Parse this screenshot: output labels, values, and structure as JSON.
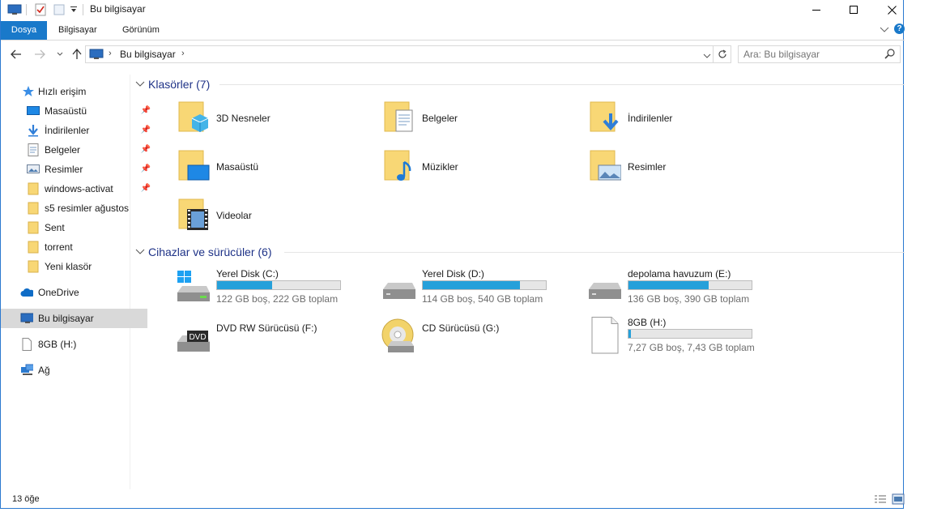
{
  "window": {
    "title": "Bu bilgisayar"
  },
  "ribbon": {
    "tabs": [
      "Dosya",
      "Bilgisayar",
      "Görünüm"
    ]
  },
  "address": {
    "location": "Bu bilgisayar"
  },
  "search": {
    "placeholder": "Ara: Bu bilgisayar"
  },
  "sidebar": {
    "quick_access": "Hızlı erişim",
    "items": [
      "Masaüstü",
      "İndirilenler",
      "Belgeler",
      "Resimler",
      "windows-activat",
      "s5 resimler ağustos",
      "Sent",
      "torrent",
      "Yeni klasör"
    ],
    "onedrive": "OneDrive",
    "this_pc": "Bu bilgisayar",
    "usb": "8GB (H:)",
    "network": "Ağ"
  },
  "folders": {
    "heading": "Klasörler (7)",
    "items": [
      "3D Nesneler",
      "Belgeler",
      "İndirilenler",
      "Masaüstü",
      "Müzikler",
      "Resimler",
      "Videolar"
    ]
  },
  "devices": {
    "heading": "Cihazlar ve sürücüler (6)",
    "items": [
      {
        "name": "Yerel Disk (C:)",
        "info": "122 GB boş, 222 GB toplam",
        "used": 0.45
      },
      {
        "name": "Yerel Disk (D:)",
        "info": "114 GB boş, 540 GB toplam",
        "used": 0.79
      },
      {
        "name": "depolama havuzum (E:)",
        "info": "136 GB boş, 390 GB toplam",
        "used": 0.65
      },
      {
        "name": "DVD RW Sürücüsü (F:)"
      },
      {
        "name": "CD Sürücüsü (G:)"
      },
      {
        "name": "8GB (H:)",
        "info": "7,27 GB boş, 7,43 GB toplam",
        "used": 0.02
      }
    ]
  },
  "status": {
    "count": "13 öğe"
  },
  "icons": {
    "dvd_label": "DVD"
  },
  "colors": {
    "accent": "#1979ca",
    "bar_fill": "#26a0da",
    "section_heading": "#1e3287",
    "folder": "#f8d775"
  }
}
